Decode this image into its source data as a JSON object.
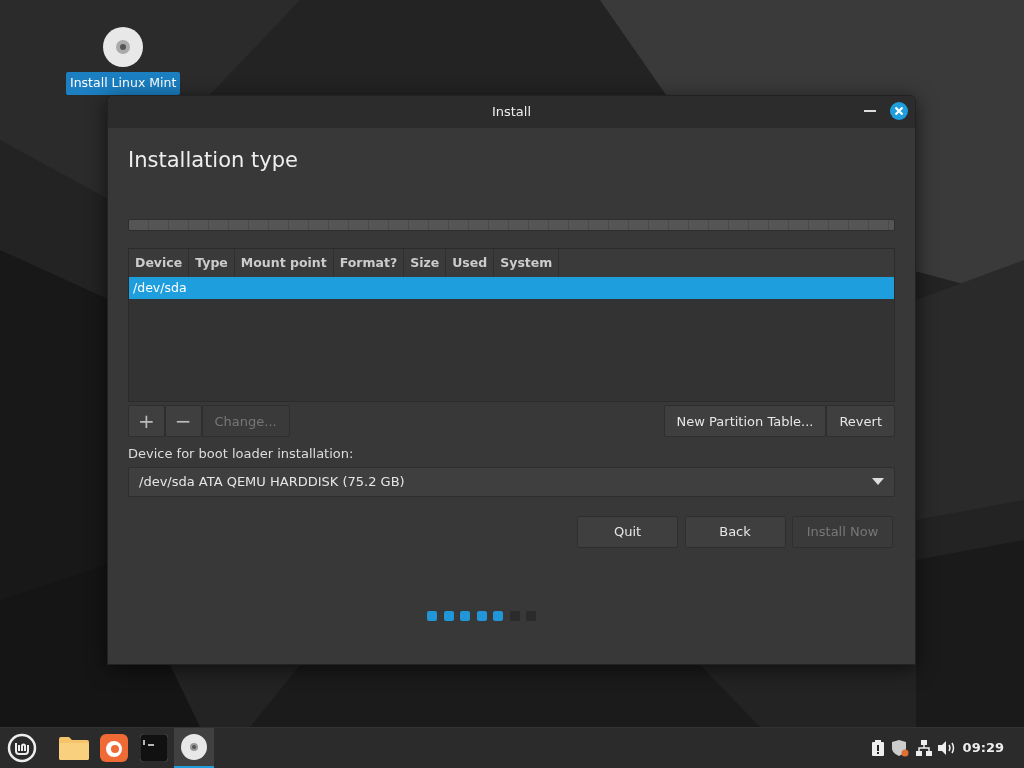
{
  "desktop_icons": [
    {
      "label": "Install Linux Mint",
      "selected": true
    }
  ],
  "window": {
    "title": "Install",
    "heading": "Installation type",
    "partition_table": {
      "columns": [
        "Device",
        "Type",
        "Mount point",
        "Format?",
        "Size",
        "Used",
        "System"
      ],
      "rows": [
        {
          "device": "/dev/sda",
          "selected": true
        }
      ]
    },
    "partition_buttons": [
      {
        "label": "+",
        "disabled": false
      },
      {
        "label": "−",
        "disabled": false
      },
      {
        "label": "Change...",
        "disabled": true
      }
    ],
    "table_buttons": [
      {
        "label": "New Partition Table...",
        "disabled": false
      },
      {
        "label": "Revert",
        "disabled": false
      }
    ],
    "boot_loader_label": "Device for boot loader installation:",
    "boot_loader_device": "/dev/sda ATA QEMU HARDDISK (75.2 GB)",
    "buttons": [
      {
        "label": "Quit",
        "disabled": false
      },
      {
        "label": "Back",
        "disabled": false
      },
      {
        "label": "Install Now",
        "disabled": true
      }
    ],
    "steps": [
      {
        "completed": true
      },
      {
        "completed": true
      },
      {
        "completed": true
      },
      {
        "completed": true
      },
      {
        "completed": true
      },
      {
        "completed": false
      },
      {
        "completed": false
      }
    ]
  },
  "taskbar": {
    "apps": [
      {
        "kind": "files",
        "selected": false
      },
      {
        "kind": "browser",
        "selected": false
      },
      {
        "kind": "terminal",
        "selected": false
      },
      {
        "kind": "disc",
        "selected": true
      }
    ],
    "clock": "09:29"
  }
}
